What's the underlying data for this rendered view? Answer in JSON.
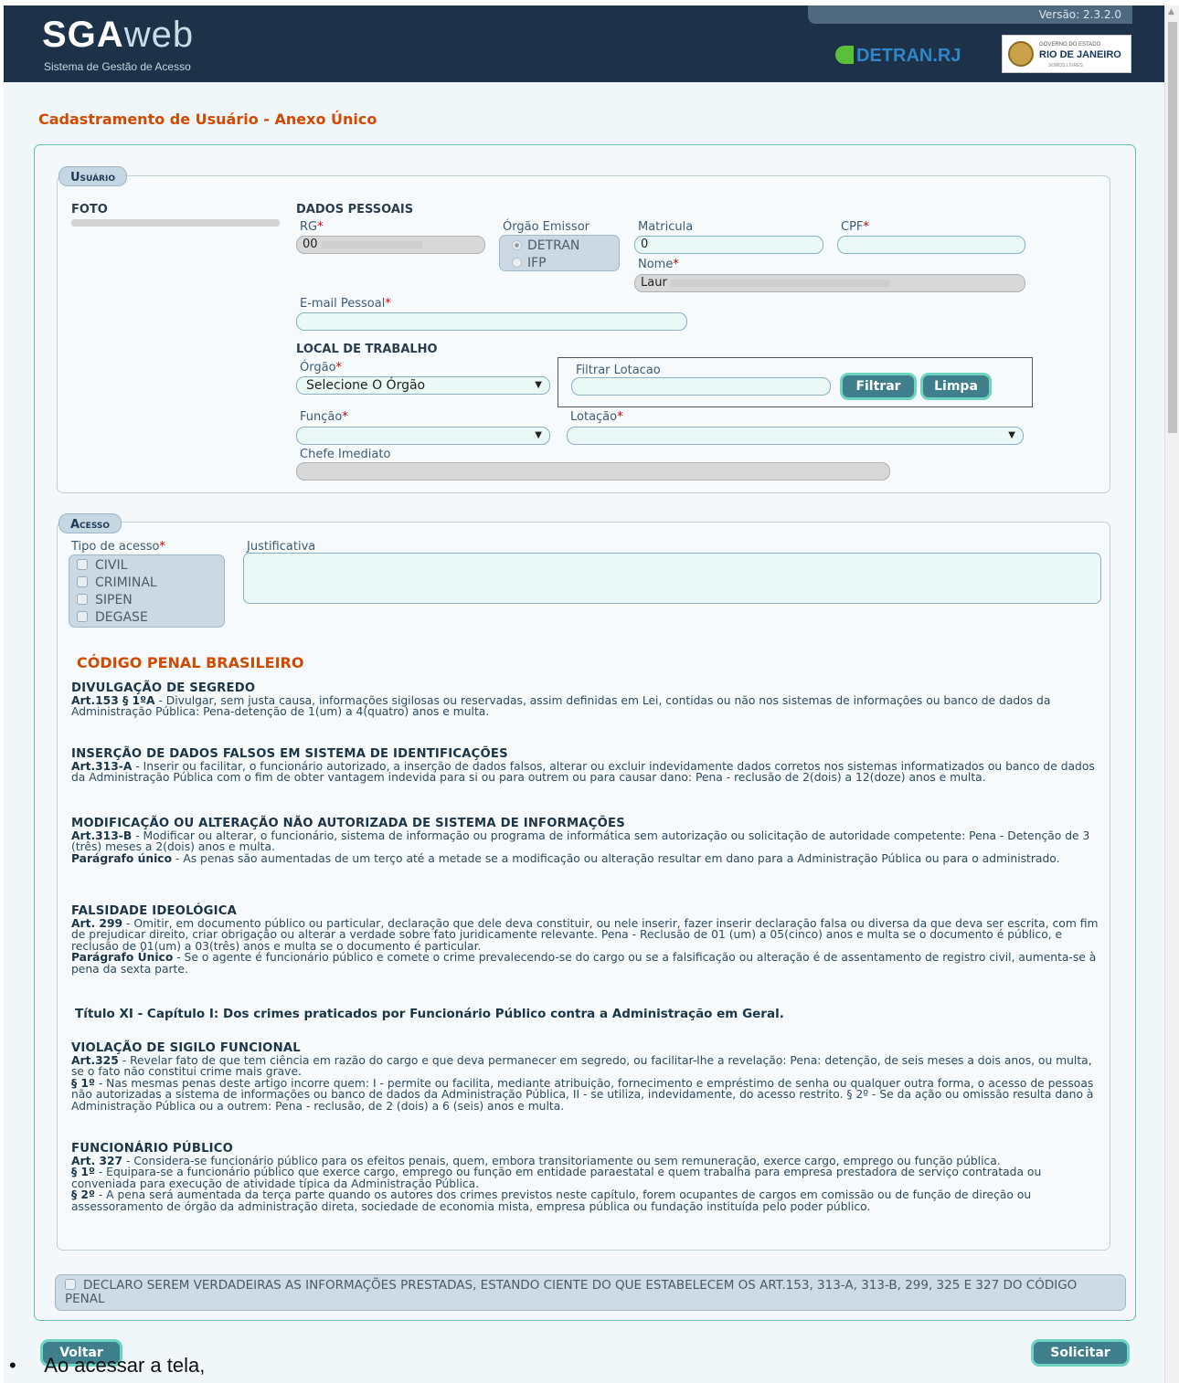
{
  "header": {
    "logo_text_sga": "SGA",
    "logo_text_web": "web",
    "logo_subtitle": "Sistema de Gestão de Acesso",
    "version": "Versão: 2.3.2.0",
    "detran_logo": "DETRAN.RJ",
    "gov_logo_small": "GOVERNO DO ESTADO",
    "gov_logo_big": "RIO DE JANEIRO",
    "gov_logo_tiny": "SOMOS LIVRES"
  },
  "page_title": "Cadastramento de Usuário - Anexo Único",
  "usuario": {
    "legend": "Usuário",
    "foto_label": "FOTO",
    "dados_pessoais": "DADOS PESSOAIS",
    "rg_label": "RG",
    "rg_value": "00",
    "orgao_emissor_label": "Órgão Emissor",
    "orgao_emissor_options": [
      "DETRAN",
      "IFP"
    ],
    "matricula_label": "Matricula",
    "matricula_value": "0",
    "cpf_label": "CPF",
    "nome_label": "Nome",
    "nome_value": "Laur",
    "email_label": "E-mail Pessoal",
    "local_trabalho": "LOCAL DE TRABALHO",
    "orgao_label": "Órgão",
    "orgao_selected": "Selecione O Órgão",
    "filtrar_lotacao_label": "Filtrar Lotacao",
    "filtrar_button": "Filtrar",
    "limpa_button": "Limpa",
    "funcao_label": "Função",
    "lotacao_label": "Lotação",
    "chefe_label": "Chefe Imediato",
    "required_mark": "*"
  },
  "acesso": {
    "legend": "Acesso",
    "tipo_label": "Tipo de acesso",
    "tipos": [
      "CIVIL",
      "CRIMINAL",
      "SIPEN",
      "DEGASE"
    ],
    "justificativa_label": "Justificativa"
  },
  "codigo_penal": {
    "title": "CÓDIGO PENAL BRASILEIRO",
    "divulgacao": {
      "heading": "DIVULGAÇÃO DE SEGREDO",
      "art": "Art.153 § 1ºA",
      "text": " - Divulgar, sem justa causa, informações sigilosas ou reservadas, assim definidas em Lei, contidas ou não nos sistemas de informações ou banco de dados da Administração Pública: Pena-detenção de 1(um) a 4(quatro) anos e multa."
    },
    "insercao": {
      "heading": "INSERÇÃO DE DADOS FALSOS EM SISTEMA DE IDENTIFICAÇÕES",
      "art": "Art.313-A",
      "text": " - Inserir ou facilitar, o funcionário autorizado, a inserção de dados falsos, alterar ou excluir indevidamente dados corretos nos sistemas informatizados ou banco de dados da Administração Pública com o fim de obter vantagem indevida para si ou para outrem ou para causar dano: Pena - reclusão de 2(dois) a 12(doze) anos e multa."
    },
    "modificacao": {
      "heading": "MODIFICAÇÃO OU ALTERAÇÃO NÃO AUTORIZADA DE SISTEMA DE INFORMAÇÕES",
      "art": "Art.313-B",
      "text": " - Modificar ou alterar, o funcionário, sistema de informação ou programa de informática sem autorização ou solicitação de autoridade competente: Pena - Detenção de 3 (três) meses a 2(dois) anos e multa.",
      "paragrafo": "Parágrafo único",
      "paragrafo_text": " - As penas são aumentadas de um terço até a metade se a modificação ou alteração resultar em dano para a Administração Pública ou para o administrado."
    },
    "falsidade": {
      "heading": "FALSIDADE IDEOLÓGICA",
      "art": "Art. 299",
      "text": " - Omitir, em documento público ou particular, declaração que dele deva constituir, ou nele inserir, fazer inserir declaração falsa ou diversa da que deva ser escrita, com fim de prejudicar direito, criar obrigação ou alterar a verdade sobre fato juridicamente relevante. Pena - Reclusão de 01 (um) a 05(cinco) anos e multa se o documento é público, e reclusão de 01(um) a 03(três) anos e multa se o documento é particular.",
      "paragrafo": "Parágrafo Único",
      "paragrafo_text": " - Se o agente é funcionário público e comete o crime prevalecendo-se do cargo ou se a falsificação ou alteração é de assentamento de registro civil, aumenta-se à pena da sexta parte."
    },
    "titulo": "Título XI - Capítulo I: Dos crimes praticados por Funcionário Público contra a Administração em Geral.",
    "violacao": {
      "heading": "VIOLAÇÃO DE SIGILO FUNCIONAL",
      "art": "Art.325",
      "text": " - Revelar fato de que tem ciência em razão do cargo e que deva permanecer em segredo, ou facilitar-lhe a revelação: Pena: detenção, de seis meses a dois anos, ou multa, se o fato não constitui crime mais grave.",
      "paragrafo": "§ 1º",
      "paragrafo_text": " - Nas mesmas penas deste artigo incorre quem: I - permite ou facilita, mediante atribuição, fornecimento e empréstimo de senha ou qualquer outra forma, o acesso de pessoas não autorizadas a sistema de informações ou banco de dados da Administração Pública, II - se utiliza, indevidamente, do acesso restrito. § 2º - Se da ação ou omissão resulta dano à Administração Pública ou a outrem: Pena - reclusão, de 2 (dois) a 6 (seis) anos e multa."
    },
    "funcionario": {
      "heading": "FUNCIONÁRIO PÚBLICO",
      "art": "Art. 327",
      "text": " - Considera-se funcionário público para os efeitos penais, quem, embora transitoriamente ou sem remuneração, exerce cargo, emprego ou função pública.",
      "p1": "§ 1º",
      "p1_text": " - Equipara-se a funcionário público que exerce cargo, emprego ou função em entidade paraestatal e quem trabalha para empresa prestadora de serviço contratada ou conveniada para execução de atividade típica da Administração Pública.",
      "p2": "§ 2º",
      "p2_text": " - A pena será aumentada da terça parte quando os autores dos crimes previstos neste capítulo, forem ocupantes de cargos em comissão ou de função de direção ou assessoramento de órgão da administração direta, sociedade de economia mista, empresa pública ou fundação instituída pelo poder público."
    }
  },
  "declaro": "DECLARO SEREM VERDADEIRAS AS INFORMAÇÕES PRESTADAS, ESTANDO CIENTE DO QUE ESTABELECEM OS ART.153, 313-A, 313-B, 299, 325 E 327 DO CÓDIGO PENAL",
  "buttons": {
    "voltar": "Voltar",
    "solicitar": "Solicitar"
  },
  "bullet_text": "Ao acessar a tela,"
}
